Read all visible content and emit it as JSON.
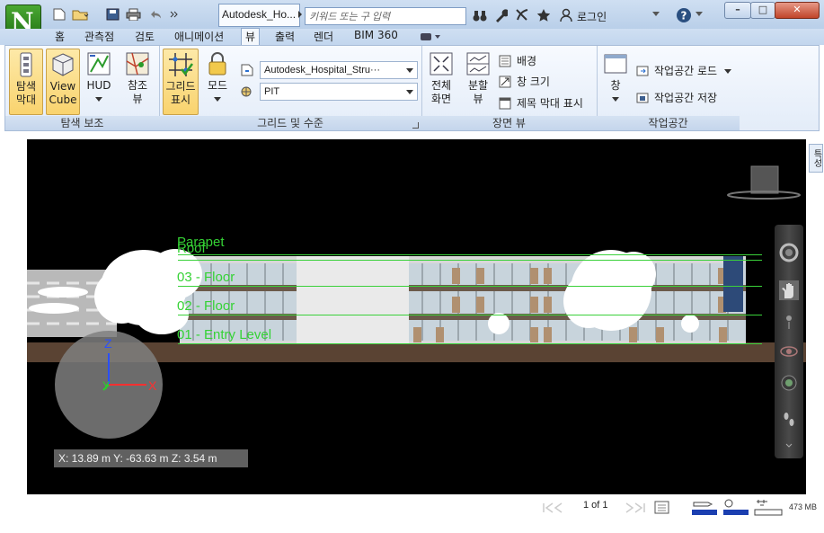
{
  "titlebar": {
    "document_title": "Autodesk_Ho...",
    "search_placeholder": "키워드 또는 구 입력",
    "login_label": "로그인",
    "help_label": "?",
    "app_logo_letter": "N"
  },
  "tabs": [
    "홈",
    "관측점",
    "검토",
    "애니메이션",
    "뷰",
    "출력",
    "렌더",
    "BIM 360"
  ],
  "active_tab": "뷰",
  "ribbon": {
    "panels": {
      "navigation_aids": {
        "label": "탐색 보조",
        "buttons": [
          {
            "label1": "탐색",
            "label2": "막대"
          },
          {
            "label1": "View",
            "label2": "Cube"
          },
          {
            "label1": "HUD",
            "label2": ""
          },
          {
            "label1": "참조",
            "label2": "뷰"
          }
        ]
      },
      "grids_levels": {
        "label": "그리드 및 수준",
        "show_grid": {
          "label1": "그리드",
          "label2": "표시"
        },
        "mode": {
          "label": "모드"
        },
        "model_combo": "Autodesk_Hospital_Stru···",
        "level_combo": "PIT"
      },
      "scene_view": {
        "label": "장면 뷰",
        "fullscreen": {
          "label1": "전체",
          "label2": "화면"
        },
        "split": {
          "label1": "분할",
          "label2": "뷰"
        },
        "background": "배경",
        "window_size": "창 크기",
        "title_bar": "제목 막대 표시"
      },
      "workspace": {
        "label": "작업공간",
        "window": "창",
        "load_workspace": "작업공간 로드",
        "save_workspace": "작업공간 저장"
      }
    }
  },
  "side_tab": "특성",
  "viewport": {
    "levels": [
      "Parapet",
      "Roof",
      "03 - Floor",
      "02 - Floor",
      "01 - Entry Level"
    ],
    "axis_x": "X",
    "axis_y": "Y",
    "axis_z": "Z",
    "coords": "X: 13.89 m  Y: -63.63 m  Z: 3.54 m"
  },
  "statusbar": {
    "page": "1 of 1",
    "memory": "473 MB"
  },
  "colors": {
    "level_green": "#3ad13a",
    "viewport_bg": "#000000",
    "ribbon_highlight": "#f9d36e"
  }
}
